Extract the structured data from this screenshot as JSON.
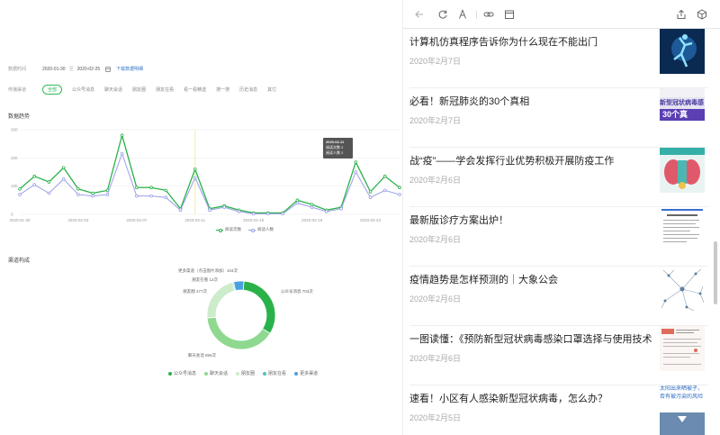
{
  "filters": {
    "date_label": "数据时间",
    "date_start": "2020-01-30",
    "date_sep": "至",
    "date_end": "2020-02-25",
    "download_label": "下载数据明细",
    "channel_label": "传播渠道",
    "channels": [
      "全部",
      "公众号消息",
      "聊天会话",
      "朋友圈",
      "朋友在看",
      "看一看精选",
      "搜一搜",
      "历史消息",
      "其它"
    ]
  },
  "trend": {
    "title": "数据趋势",
    "legend": [
      "阅读次数",
      "阅读人数"
    ],
    "tooltip": {
      "date": "2020-02-11",
      "line1": "阅读次数 2",
      "line2": "阅读人数 2"
    }
  },
  "channels_section": {
    "title": "渠道构成"
  },
  "colors": {
    "green_dark": "#2ab24a",
    "green_mid": "#8ed98f",
    "green_light": "#cdeccb",
    "teal": "#4dc3c2",
    "blue": "#4a9fe0",
    "series_reads": "#2ab24a",
    "series_readers": "#9b9fe8"
  },
  "chart_data": [
    {
      "type": "line",
      "title": "数据趋势",
      "x": [
        "2020-01-30",
        "2020-01-31",
        "2020-02-01",
        "2020-02-02",
        "2020-02-03",
        "2020-02-04",
        "2020-02-05",
        "2020-02-06",
        "2020-02-07",
        "2020-02-08",
        "2020-02-09",
        "2020-02-10",
        "2020-02-11",
        "2020-02-12",
        "2020-02-13",
        "2020-02-14",
        "2020-02-15",
        "2020-02-16",
        "2020-02-17",
        "2020-02-18",
        "2020-02-19",
        "2020-02-20",
        "2020-02-21",
        "2020-02-22",
        "2020-02-23",
        "2020-02-24",
        "2020-02-25"
      ],
      "x_tick_labels": [
        "2020-01-30",
        "2020-02-03",
        "2020-02-07",
        "2020-02-11",
        "2020-02-15",
        "2020-02-19",
        "2020-02-23"
      ],
      "y_ticks": [
        0,
        100,
        200,
        300
      ],
      "ylim": [
        0,
        300
      ],
      "series": [
        {
          "name": "阅读次数",
          "values": [
            90,
            135,
            115,
            165,
            90,
            75,
            85,
            280,
            95,
            95,
            85,
            20,
            160,
            20,
            30,
            15,
            5,
            5,
            5,
            50,
            35,
            15,
            25,
            185,
            80,
            135,
            95
          ]
        },
        {
          "name": "阅读人数",
          "values": [
            70,
            105,
            75,
            125,
            70,
            65,
            70,
            215,
            65,
            65,
            60,
            15,
            130,
            15,
            25,
            10,
            2,
            2,
            2,
            40,
            25,
            10,
            20,
            150,
            60,
            85,
            70
          ]
        }
      ],
      "grid": true,
      "legend_position": "bottom"
    },
    {
      "type": "pie",
      "title": "渠道构成",
      "labels": [
        "公众号消息",
        "聊天会话",
        "朋友圈",
        "朋友在看",
        "更多渠道（点击图片添加）"
      ],
      "display_labels": [
        "公众号消息 703次",
        "聊天会话 856次",
        "朋友圈 477次",
        "朋友在看 12次",
        "更多渠道（点击图片添加）104次"
      ],
      "values": [
        703,
        856,
        477,
        12,
        104
      ],
      "legend": [
        "公众号消息",
        "聊天会话",
        "朋友圈",
        "朋友在看",
        "更多渠道"
      ],
      "legend_position": "bottom"
    }
  ],
  "articles": [
    {
      "title": "计算机仿真程序告诉你为什么现在不能出门",
      "date": "2020年2月7日",
      "thumb": "virus-figure"
    },
    {
      "title": "必看！新冠肺炎的30个真相",
      "date": "2020年2月7日",
      "thumb": "purple-banner",
      "thumb_text1": "新型冠状病毒感",
      "thumb_text2": "30个真"
    },
    {
      "title": "战“疫”——学会发挥行业优势积极开展防疫工作",
      "date": "2020年2月6日",
      "thumb": "medical-illustration"
    },
    {
      "title": "最新版诊疗方案出炉！",
      "date": "2020年2月6日",
      "thumb": "document"
    },
    {
      "title": "疫情趋势是怎样预测的｜大象公会",
      "date": "2020年2月6日",
      "thumb": "network-graph"
    },
    {
      "title": "一图读懂：《预防新型冠状病毒感染口罩选择与使用技术指引》",
      "date": "2020年2月6日",
      "thumb": "infographic"
    },
    {
      "title": "速看！小区有人感染新型冠状病毒，怎么办？",
      "date": "2020年2月5日",
      "thumb": "blue-text",
      "thumb_text1": "太阳出来晒被子，",
      "thumb_text2": "否有被污染的风险"
    }
  ]
}
